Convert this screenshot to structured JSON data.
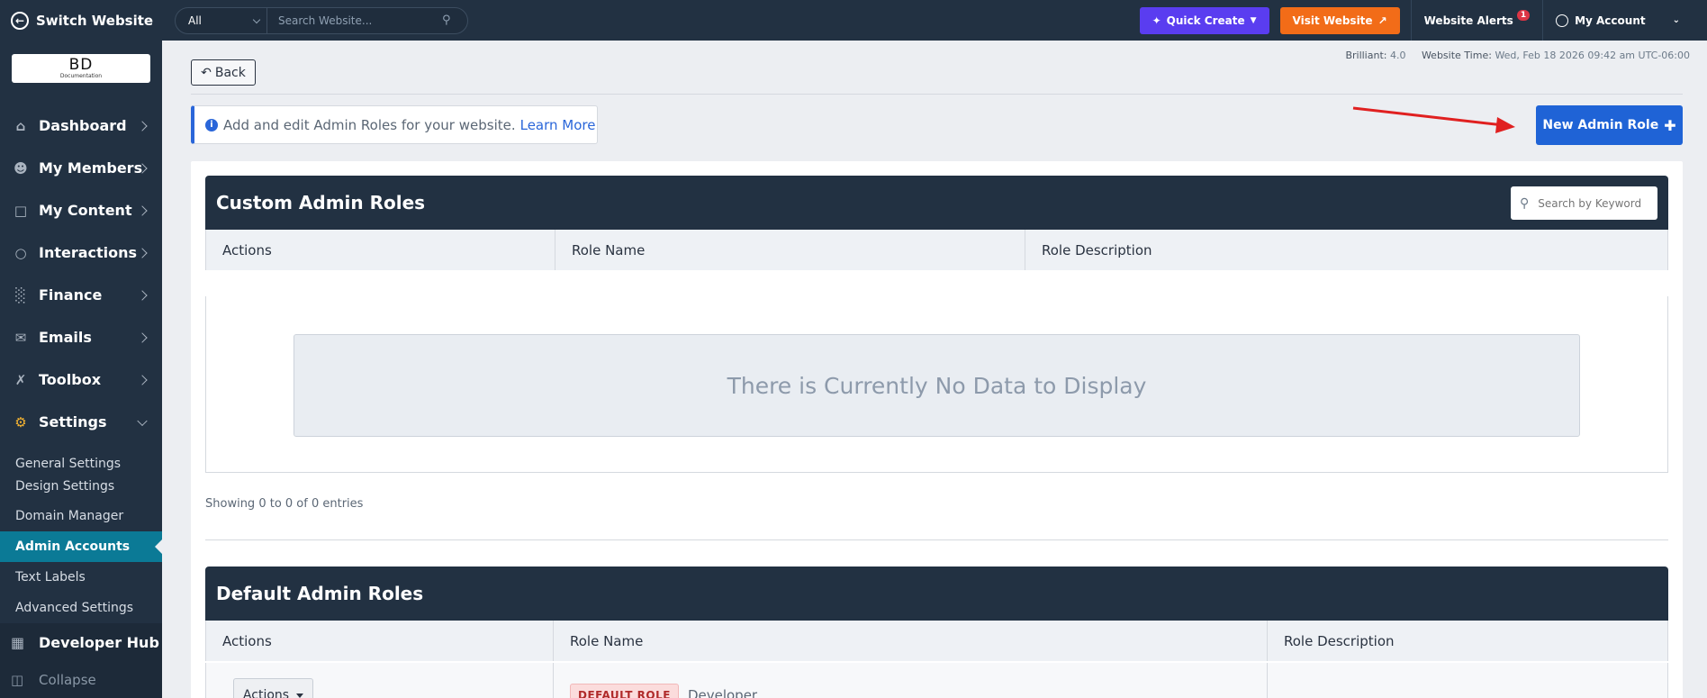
{
  "sidebar": {
    "switch_label": "Switch Website",
    "logo": {
      "big": "BD",
      "small": "Documentation"
    },
    "nav": [
      {
        "label": "Dashboard",
        "icon": "home-icon"
      },
      {
        "label": "My Members",
        "icon": "users-icon"
      },
      {
        "label": "My Content",
        "icon": "folder-icon"
      },
      {
        "label": "Interactions",
        "icon": "chat-icon"
      },
      {
        "label": "Finance",
        "icon": "bar-chart-icon"
      },
      {
        "label": "Emails",
        "icon": "envelope-icon"
      },
      {
        "label": "Toolbox",
        "icon": "tools-icon"
      },
      {
        "label": "Settings",
        "icon": "gear-icon"
      }
    ],
    "settings_sub": [
      {
        "label": "General Settings"
      },
      {
        "label": "Design Settings"
      },
      {
        "label": "Domain Manager"
      },
      {
        "label": "Admin Accounts"
      },
      {
        "label": "Text Labels"
      },
      {
        "label": "Advanced Settings"
      }
    ],
    "developer_hub": "Developer Hub",
    "collapse": "Collapse"
  },
  "topbar": {
    "scope_select": "All",
    "search_placeholder": "Search Website...",
    "quick_create": "Quick Create",
    "visit_website": "Visit Website",
    "website_alerts": "Website Alerts",
    "alerts_count": "1",
    "my_account": "My Account"
  },
  "status": {
    "version_label": "Brilliant:",
    "version": "4.0",
    "time_label": "Website Time:",
    "time": "Wed, Feb 18 2026 09:42 am UTC-06:00"
  },
  "page": {
    "back_label": "Back",
    "info_text": "Add and edit Admin Roles for your website.",
    "info_link": "Learn More",
    "new_role_label": "New Admin Role"
  },
  "custom_roles": {
    "title": "Custom Admin Roles",
    "search_placeholder": "Search by Keyword",
    "columns": [
      "Actions",
      "Role Name",
      "Role Description"
    ],
    "empty_text": "There is Currently No Data to Display",
    "showing": "Showing 0 to 0 of 0 entries"
  },
  "default_roles": {
    "title": "Default Admin Roles",
    "columns": [
      "Actions",
      "Role Name",
      "Role Description"
    ],
    "rows": [
      {
        "actions": "Actions",
        "badge": "DEFAULT ROLE",
        "name": "Developer",
        "description": ""
      }
    ]
  },
  "colors": {
    "sidebar_bg": "#223142",
    "accent_blue": "#1f63d6",
    "quick_create": "#5a3df0",
    "visit_website": "#f26c18",
    "active_sub": "#0b7a96"
  }
}
